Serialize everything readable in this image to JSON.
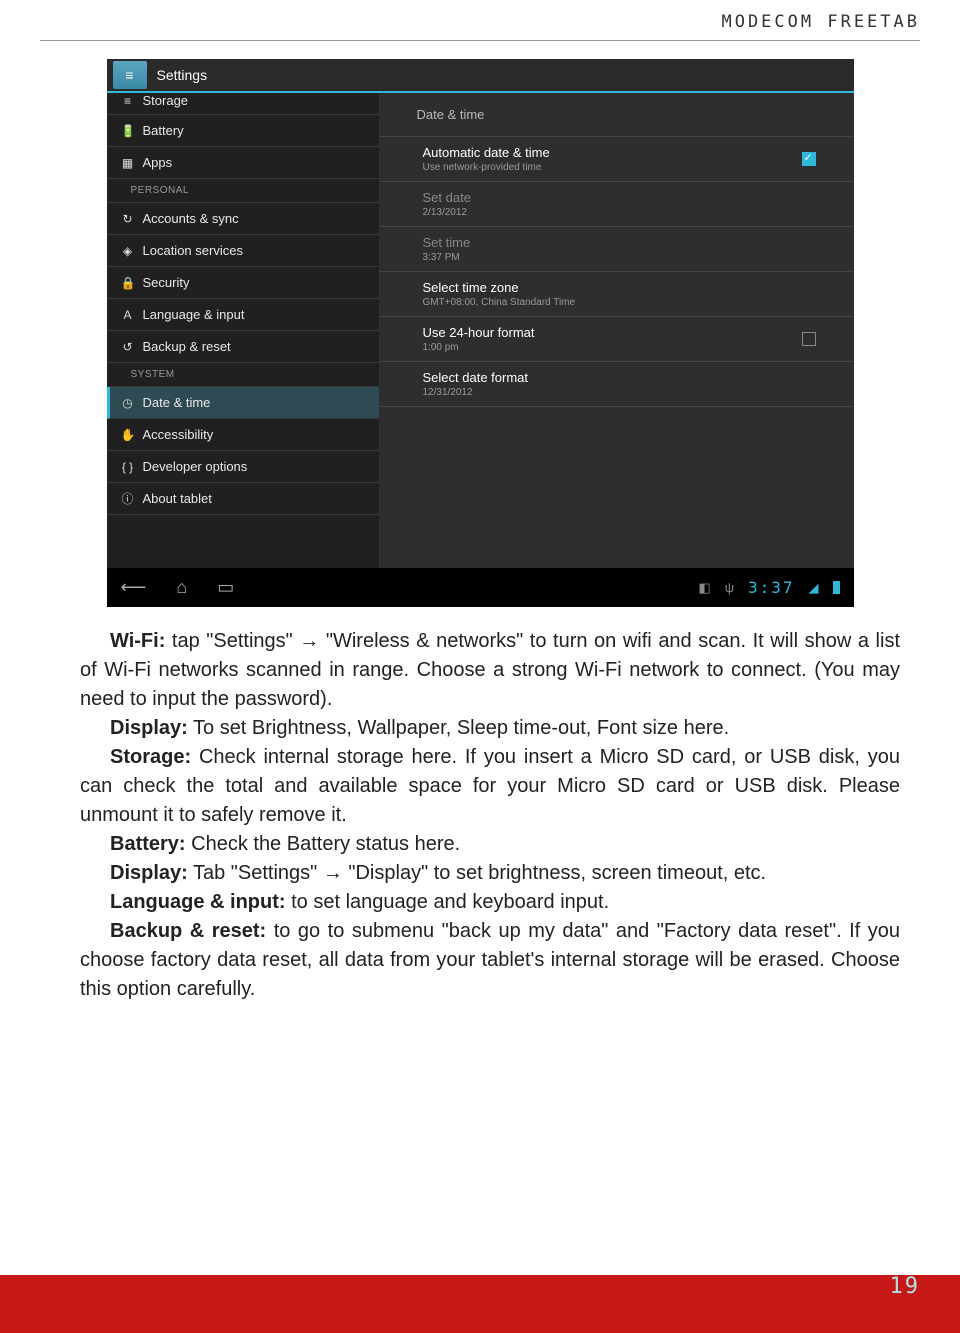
{
  "header": {
    "brand": "MODECOM FREETAB"
  },
  "screenshot": {
    "title": "Settings",
    "sidebar": {
      "partial": {
        "label": "Storage",
        "icon": "≡"
      },
      "items1": [
        {
          "label": "Battery",
          "icon": "🔋"
        },
        {
          "label": "Apps",
          "icon": "▦"
        }
      ],
      "heading_personal": "PERSONAL",
      "items2": [
        {
          "label": "Accounts & sync",
          "icon": "↻"
        },
        {
          "label": "Location services",
          "icon": "◈"
        },
        {
          "label": "Security",
          "icon": "🔒"
        },
        {
          "label": "Language & input",
          "icon": "A"
        },
        {
          "label": "Backup & reset",
          "icon": "↺"
        }
      ],
      "heading_system": "SYSTEM",
      "items3": [
        {
          "label": "Date & time",
          "icon": "◷",
          "active": true
        },
        {
          "label": "Accessibility",
          "icon": "✋"
        },
        {
          "label": "Developer options",
          "icon": "{ }"
        },
        {
          "label": "About tablet",
          "icon": "ⓘ"
        }
      ]
    },
    "main": {
      "title": "Date & time",
      "settings": [
        {
          "title": "Automatic date & time",
          "sub": "Use network-provided time",
          "check": "checked"
        },
        {
          "title": "Set date",
          "sub": "2/13/2012",
          "disabled": true
        },
        {
          "title": "Set time",
          "sub": "3:37 PM",
          "disabled": true
        },
        {
          "title": "Select time zone",
          "sub": "GMT+08:00, China Standard Time"
        },
        {
          "title": "Use 24-hour format",
          "sub": "1:00 pm",
          "check": "unchecked"
        },
        {
          "title": "Select date format",
          "sub": "12/31/2012"
        }
      ]
    },
    "navbar": {
      "clock": "3:37"
    }
  },
  "body": {
    "wifi_label": "Wi-Fi:",
    "wifi_text": " tap \"Settings\" → \"Wireless & networks\" to turn on wifi and scan. It will show a list of Wi-Fi networks scanned in range. Choose a strong Wi-Fi network to connect. (You may need to input the password).",
    "display_label": "Display:",
    "display_text": " To set Brightness, Wallpaper, Sleep time-out, Font size here.",
    "storage_label": "Storage:",
    "storage_text": " Check internal storage here. If you insert a Micro SD card, or USB disk, you can check the total and available space for your Micro SD card or USB disk. Please unmount it to safely remove it.",
    "battery_label": "Battery:",
    "battery_text": " Check the Battery status here.",
    "display2_label": "Display:",
    "display2_text": " Tab \"Settings\" → \"Display\" to set brightness, screen timeout, etc.",
    "lang_label": "Language & input:",
    "lang_text": " to set language and keyboard input.",
    "backup_label": "Backup & reset:",
    "backup_text": " to go to submenu \"back up my data\" and \"Factory data reset\". If you choose factory data reset, all data from your tablet's internal storage will be erased. Choose this option carefully."
  },
  "pagenum": "19"
}
